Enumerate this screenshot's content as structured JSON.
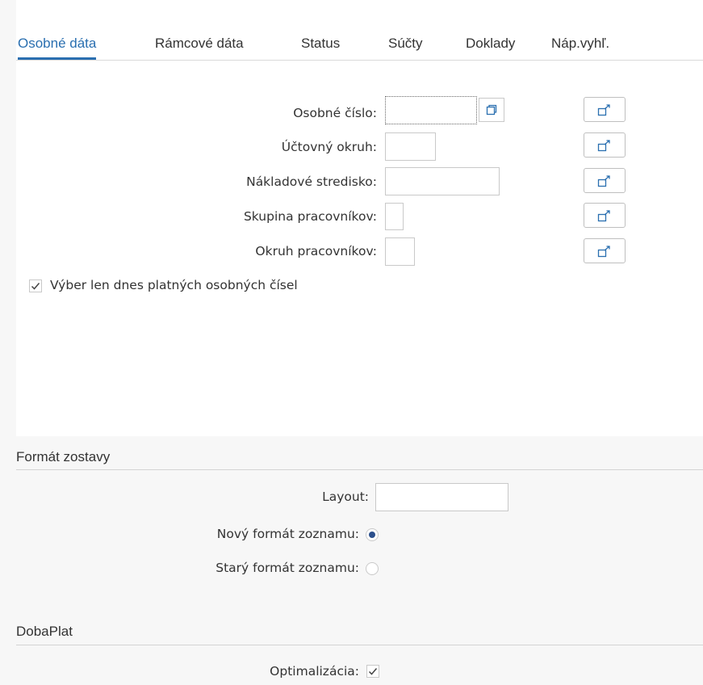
{
  "tabs": [
    {
      "label": "Osobné dáta",
      "active": true
    },
    {
      "label": "Rámcové dáta",
      "active": false
    },
    {
      "label": "Status",
      "active": false
    },
    {
      "label": "Súčty",
      "active": false
    },
    {
      "label": "Doklady",
      "active": false
    },
    {
      "label": "Náp.vyhľ.",
      "active": false
    }
  ],
  "fields": {
    "osobne_cislo": {
      "label": "Osobné číslo:",
      "value": ""
    },
    "uctovny_okruh": {
      "label": "Účtovný okruh:",
      "value": ""
    },
    "nakladove_stredisko": {
      "label": "Nákladové stredisko:",
      "value": ""
    },
    "skupina_pracovnikov": {
      "label": "Skupina pracovníkov:",
      "value": ""
    },
    "okruh_pracovnikov": {
      "label": "Okruh pracovníkov:",
      "value": ""
    }
  },
  "valid_today_checkbox": {
    "label": "Výber len dnes platných osobných čísel",
    "checked": true
  },
  "report_format": {
    "title": "Formát zostavy",
    "layout": {
      "label": "Layout:",
      "value": ""
    },
    "new_format": {
      "label": "Nový formát zoznamu:",
      "selected": true
    },
    "old_format": {
      "label": "Starý formát zoznamu:",
      "selected": false
    }
  },
  "doba_plat": {
    "title": "DobaPlat",
    "optimization": {
      "label": "Optimalizácia:",
      "checked": true
    }
  },
  "icons": {
    "value_help": "value-help-icon",
    "multiple_selection": "multiple-selection-icon",
    "checkmark": "checkmark-icon"
  },
  "colors": {
    "accent": "#2a6fb0",
    "radio_selected": "#2b4f8c"
  }
}
